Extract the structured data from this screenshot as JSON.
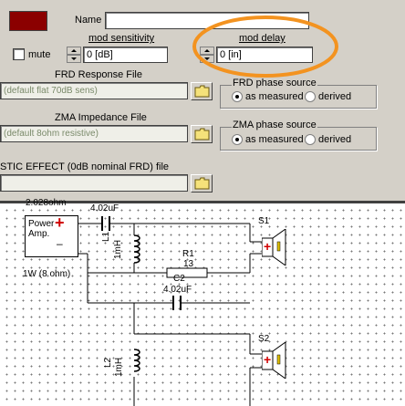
{
  "name_label": "Name",
  "name_value": "",
  "mute_label": "mute",
  "mod_sensitivity": {
    "label": "mod sensitivity",
    "value": "0 [dB]"
  },
  "mod_delay": {
    "label": "mod delay",
    "value": "0 [in]"
  },
  "frd": {
    "label": "FRD Response File",
    "value": "(default flat 70dB sens)",
    "phase_title": "FRD phase source",
    "as_measured": "as measured",
    "derived": "derived"
  },
  "zma": {
    "label": "ZMA Impedance File",
    "value": "(default 8ohm resistive)",
    "phase_title": "ZMA phase source",
    "as_measured": "as measured",
    "derived": "derived"
  },
  "acoustic": {
    "label": "STIC EFFECT (0dB nominal FRD) file",
    "value": ""
  },
  "colors": {
    "swatch": "#8b0000",
    "highlight": "#f39320"
  },
  "schematic": {
    "top_partial": "2.028ohm",
    "power_amp": "Power\nAmp.",
    "power_rating": "1W (8 ohm)",
    "c1": "4.02uF",
    "l1_name": "L1",
    "l1_value": "1mH",
    "r1_name": "R1",
    "r1_value": "13",
    "c2_name": "C2",
    "c2_value": "4.02uF",
    "s1": "S1",
    "s2": "S2",
    "l2_name": "L2",
    "l2_value": "1mH"
  }
}
